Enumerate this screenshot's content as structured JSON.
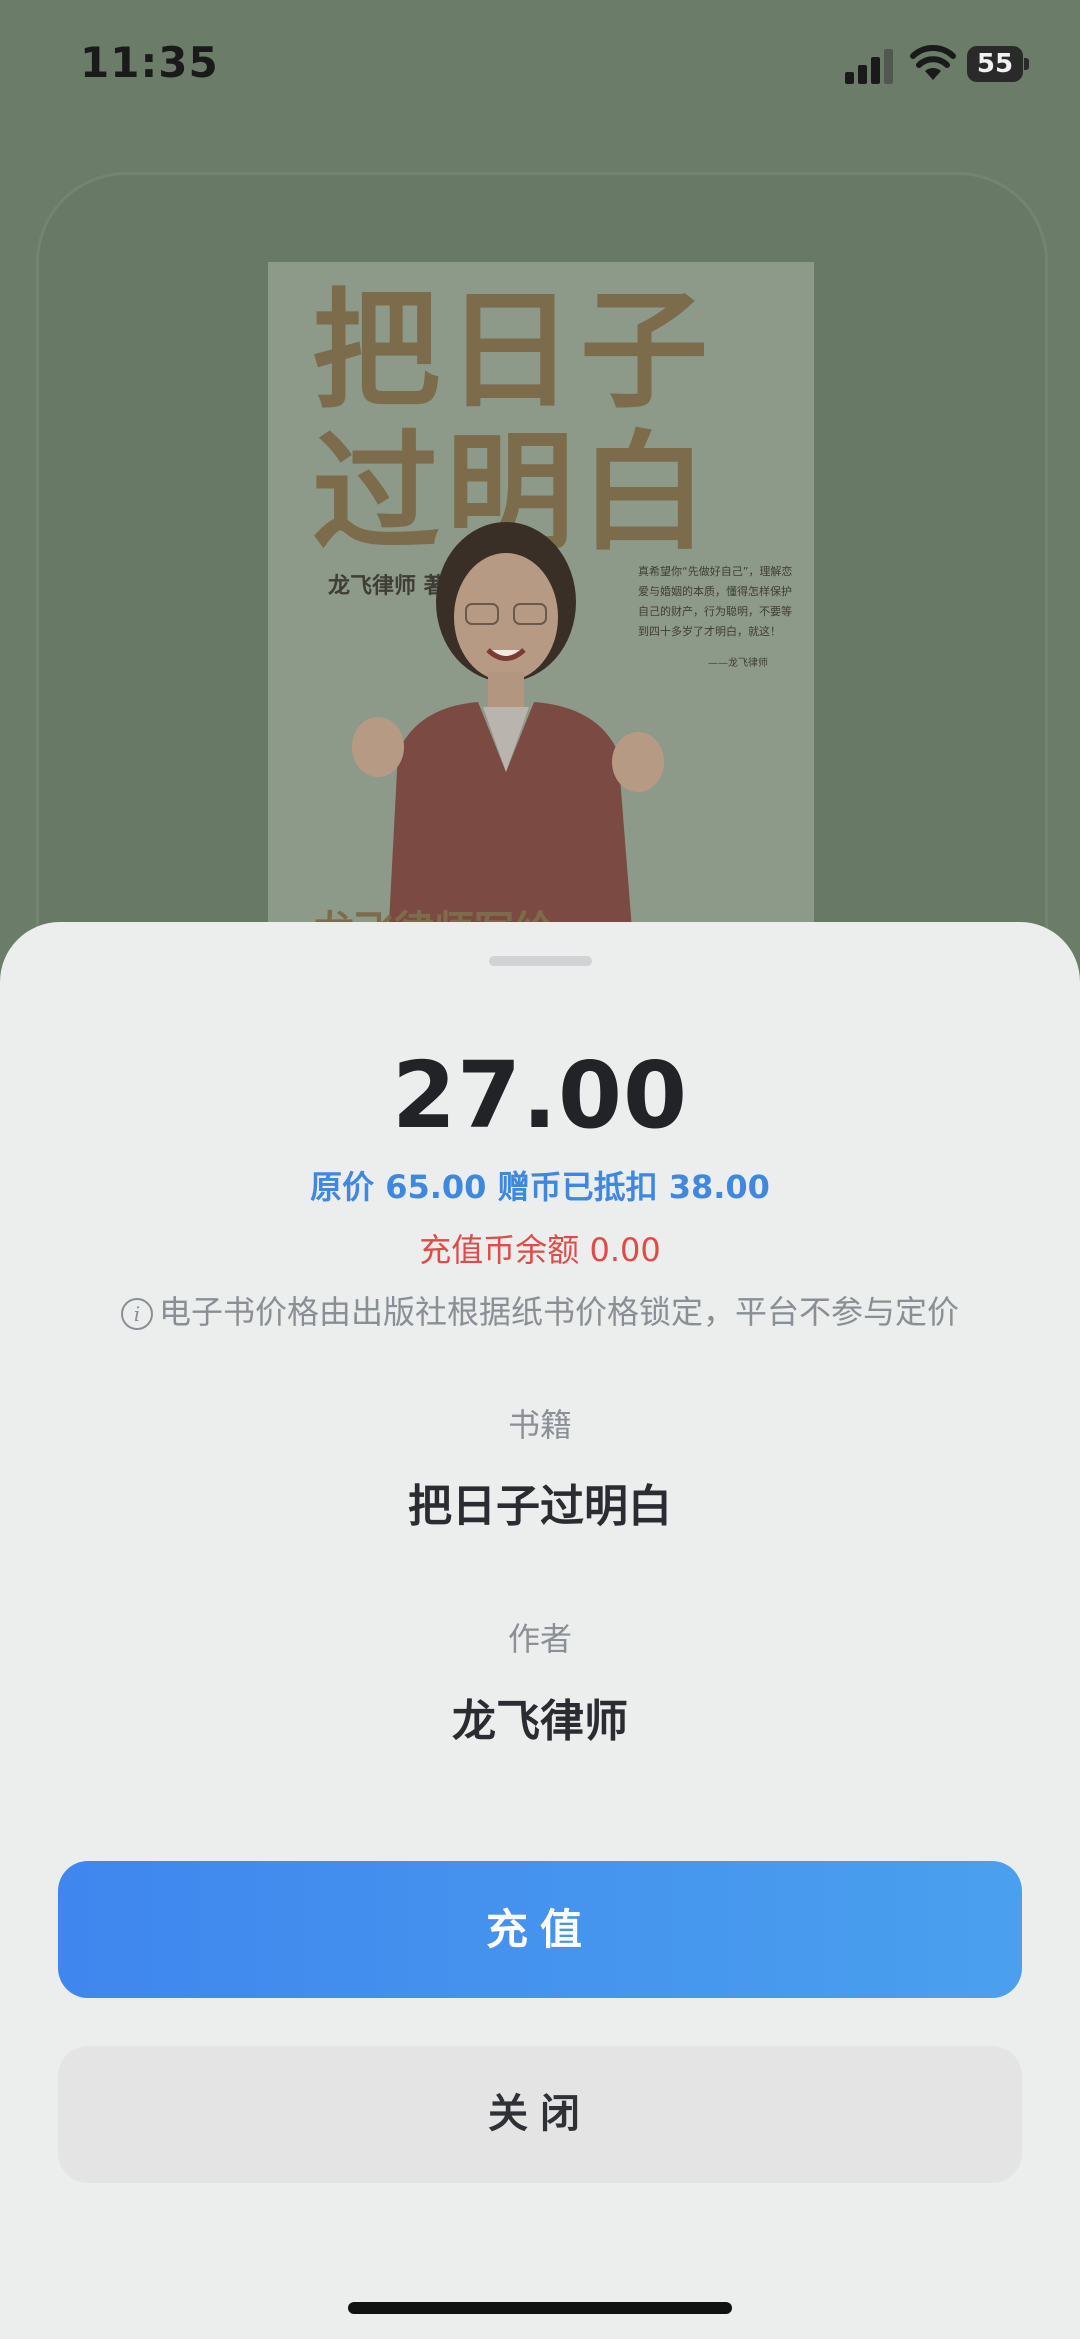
{
  "status_bar": {
    "time": "11:35",
    "battery_level": "55"
  },
  "book_cover": {
    "title_line1": "把日子",
    "title_line2": "过明白",
    "author_line": "龙飞律师 著",
    "quote": "真希望你“先做好自己”，理解恋爱与婚姻的本质，懂得怎样保护自己的财产，行为聪明，不要等到四十多岁了才明白，就这！",
    "quote_signature": "——龙飞律师",
    "bottom_text": "龙飞律师写给..."
  },
  "sheet": {
    "price": "27.00",
    "original_price_line": "原价 65.00 赠币已抵扣 38.00",
    "recharge_balance_line": "充值币余额 0.00",
    "notice_icon": "i",
    "notice": "电子书价格由出版社根据纸书价格锁定，平台不参与定价",
    "book_label": "书籍",
    "book_name": "把日子过明白",
    "author_label": "作者",
    "author_name": "龙飞律师",
    "recharge_button": "充值",
    "close_button": "关闭"
  },
  "colors": {
    "accent_blue": "#3f88e0",
    "balance_red": "#df4b47",
    "backdrop_green": "#6b7d68"
  }
}
